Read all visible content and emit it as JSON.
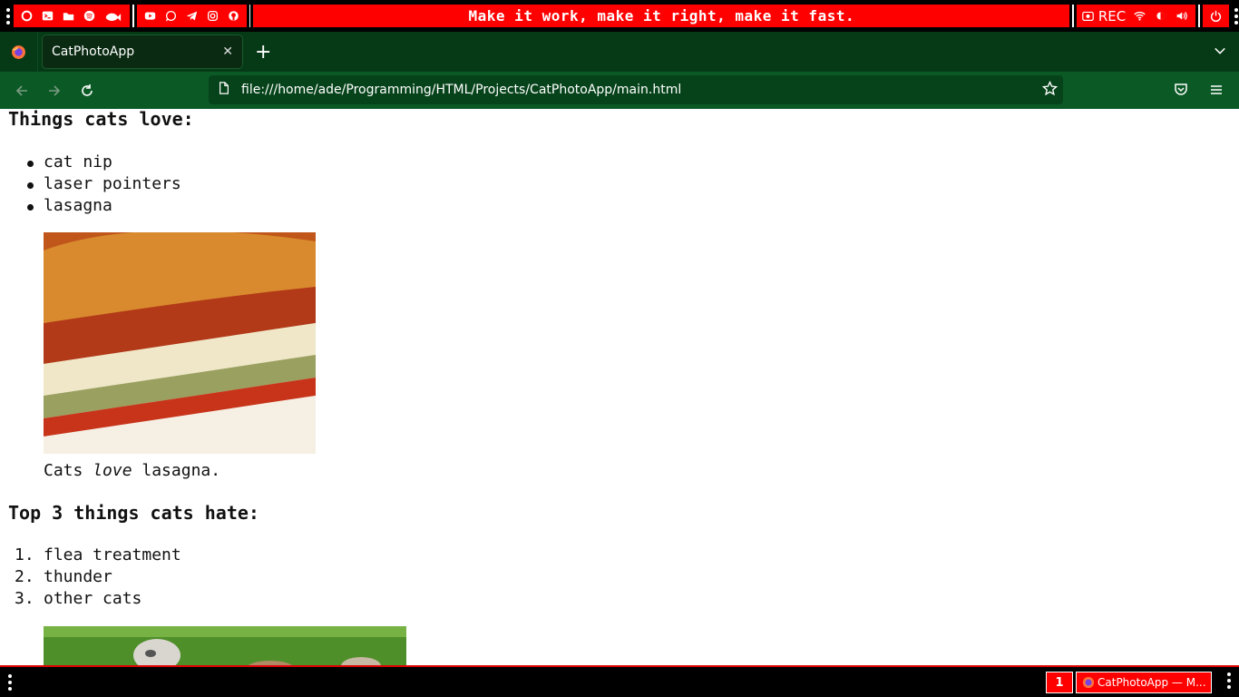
{
  "topbar": {
    "motto": "Make it work, make it right, make it fast.",
    "rec_label": "REC",
    "left_icons": [
      "debian-icon",
      "terminal-icon",
      "folder-icon",
      "spotify-icon",
      "fish-icon"
    ],
    "app_icons": [
      "youtube-icon",
      "whatsapp-icon",
      "telegram-icon",
      "instagram-icon",
      "github-icon"
    ],
    "status_icons": [
      "screenshot-icon",
      "wifi-icon",
      "brightness-icon",
      "volume-icon"
    ]
  },
  "browser": {
    "tab_title": "CatPhotoApp",
    "url": "file:///home/ade/Programming/HTML/Projects/CatPhotoApp/main.html"
  },
  "page": {
    "love_heading": "Things cats love:",
    "love_items": [
      "cat nip",
      "laser pointers",
      "lasagna"
    ],
    "caption_pre": "Cats ",
    "caption_em": "love",
    "caption_post": " lasagna.",
    "hate_heading": "Top 3 things cats hate:",
    "hate_items": [
      "flea treatment",
      "thunder",
      "other cats"
    ]
  },
  "taskbar": {
    "workspace": "1",
    "window_title": "CatPhotoApp — M..."
  },
  "colors": {
    "accent": "#ff0000",
    "browser_green": "#063a17",
    "nav_green": "#0b5a26"
  }
}
